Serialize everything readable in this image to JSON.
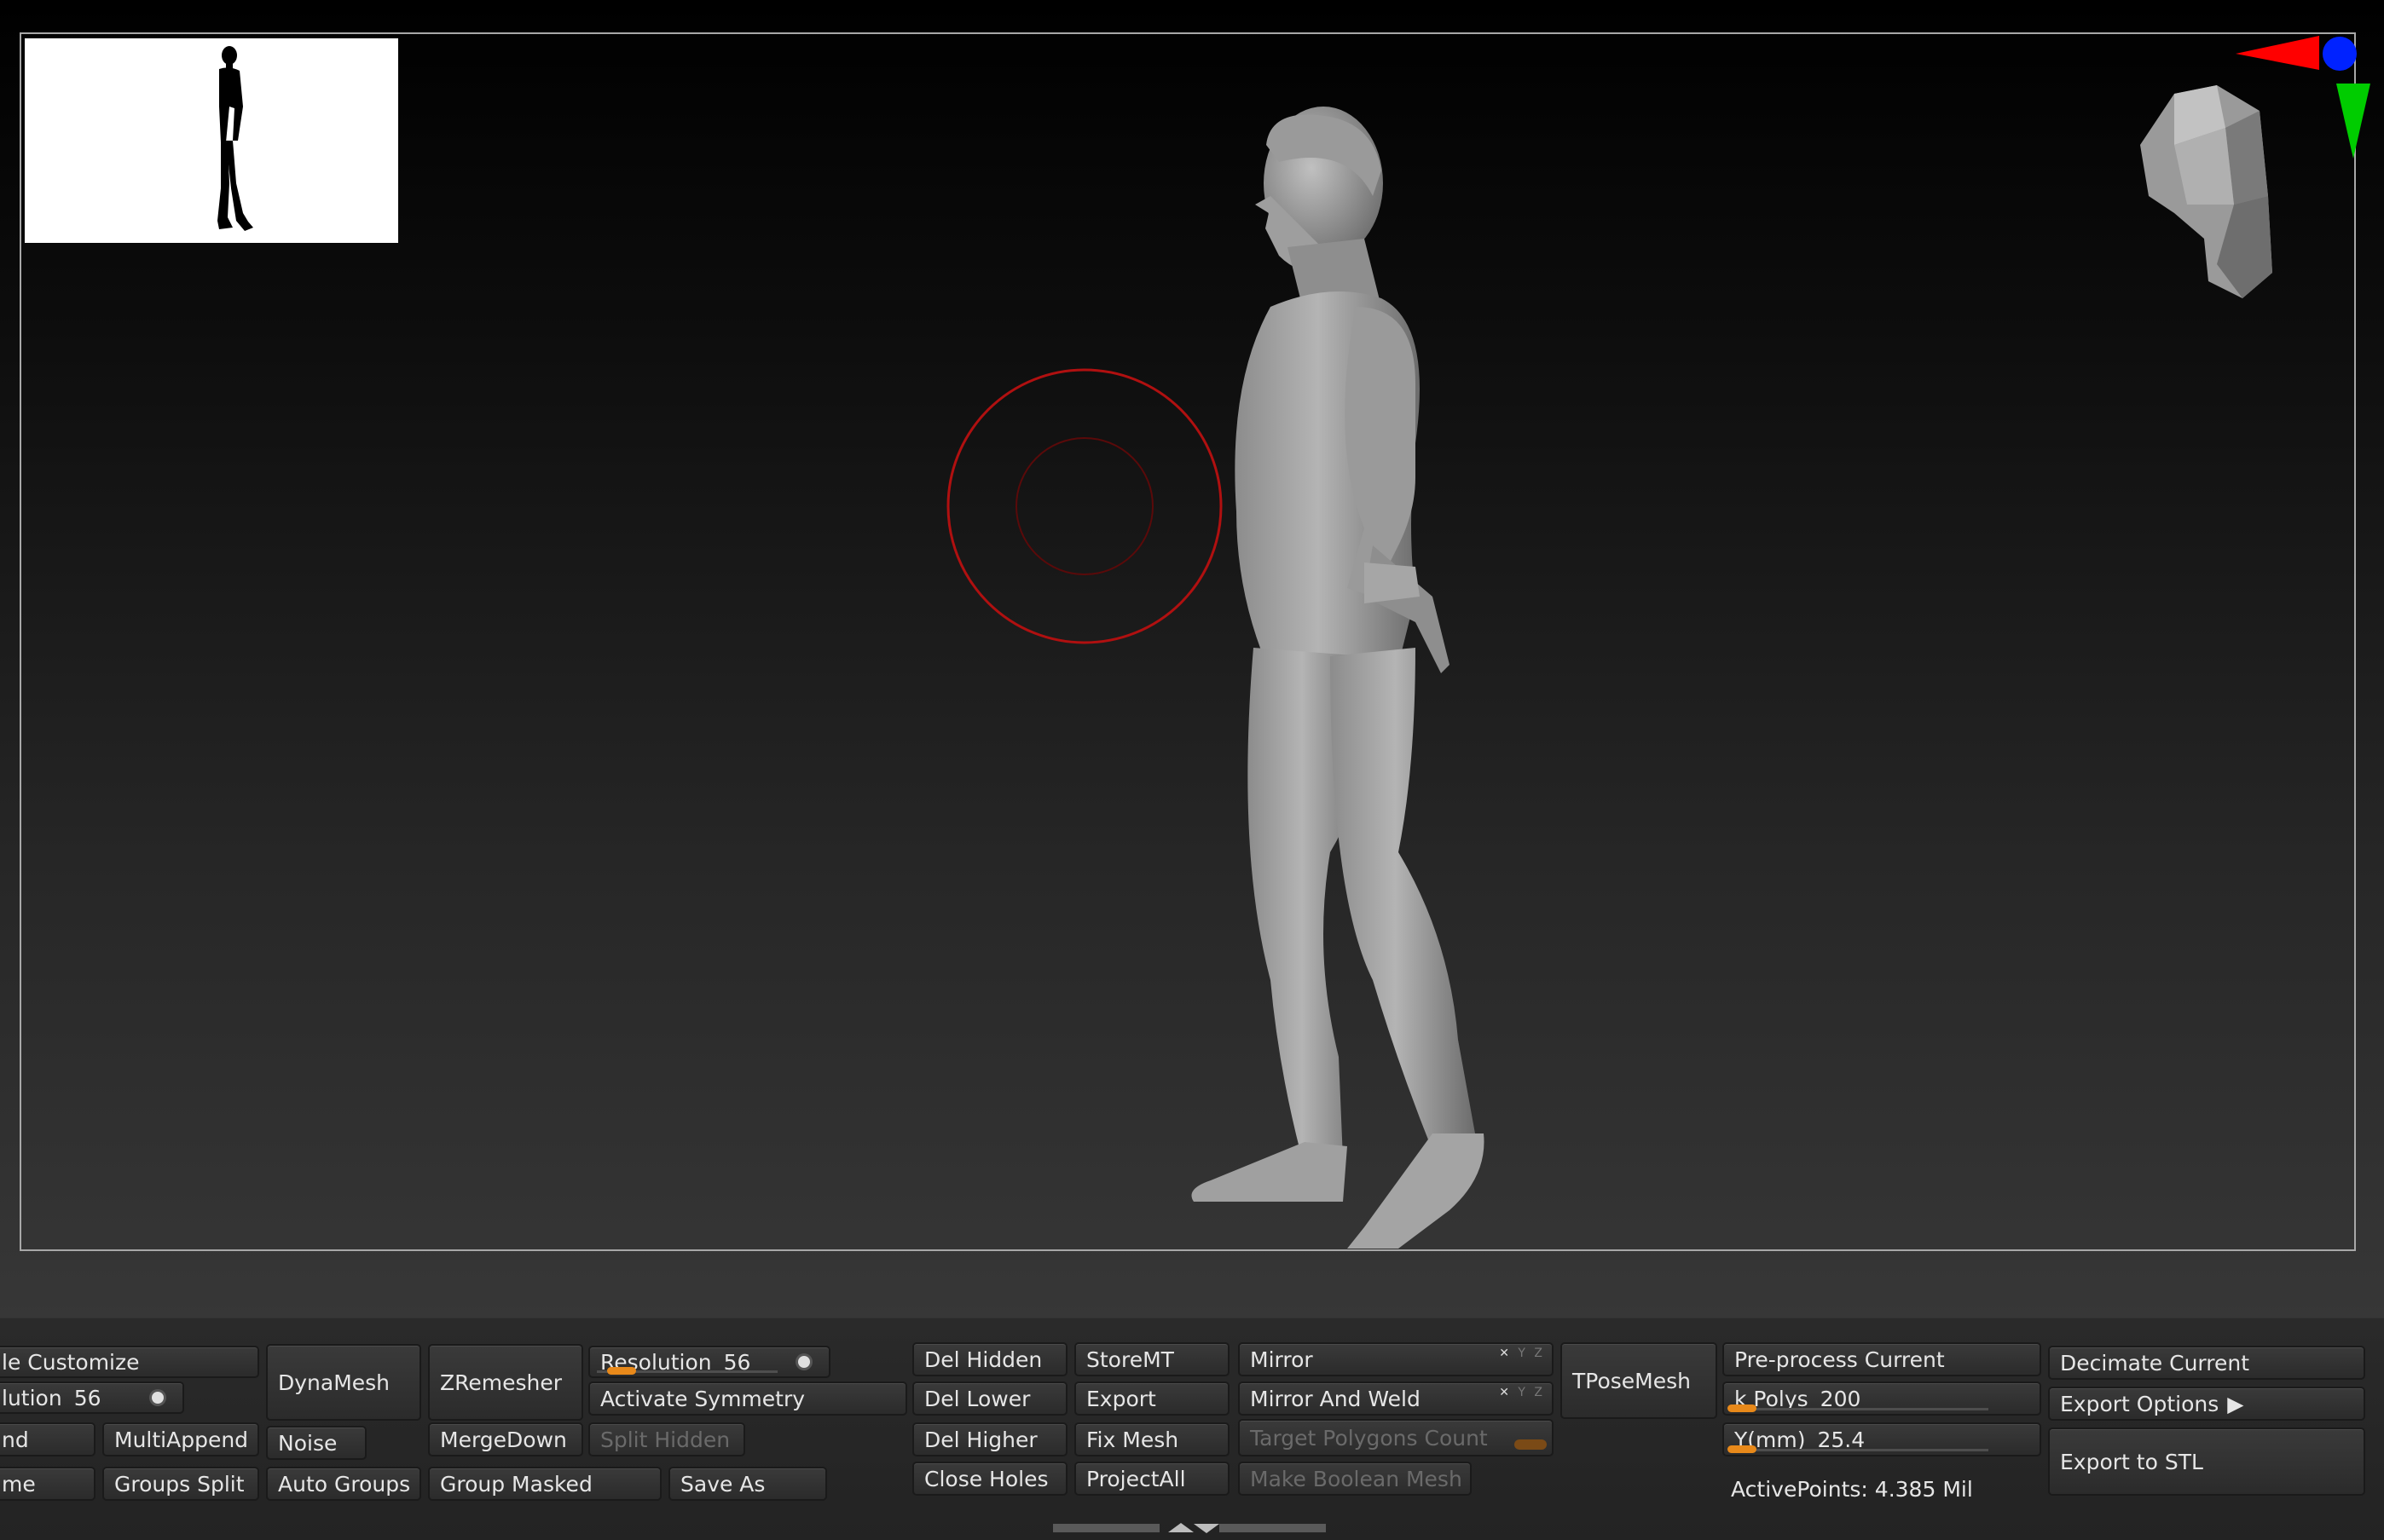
{
  "tray": {
    "col1": {
      "customize": "le Customize",
      "resolution_label": "lution",
      "resolution_value": "56",
      "append": "nd",
      "rename": "me"
    },
    "multiappend": "MultiAppend",
    "groups_split": "Groups Split",
    "dynamesh": "DynaMesh",
    "noise": "Noise",
    "auto_groups": "Auto Groups",
    "zremesher": "ZRemesher",
    "mergedown": "MergeDown",
    "group_masked": "Group Masked",
    "resolution": {
      "label": "Resolution",
      "value": "56",
      "level": 0.1
    },
    "activate_symmetry": "Activate Symmetry",
    "split_hidden": "Split Hidden",
    "save_as": "Save As",
    "del_hidden": "Del Hidden",
    "del_lower": "Del Lower",
    "del_higher": "Del Higher",
    "close_holes": "Close Holes",
    "storemt": "StoreMT",
    "export": "Export",
    "fix_mesh": "Fix Mesh",
    "projectall": "ProjectAll",
    "mirror": "Mirror",
    "mirror_and_weld": "Mirror And Weld",
    "target_polygons_count": "Target Polygons Count",
    "make_boolean_mesh": "Make Boolean Mesh",
    "tposemesh": "TPoseMesh",
    "preprocess_current": "Pre-process Current",
    "kpolys": {
      "label": "k Polys",
      "value": "200",
      "level": 0.05
    },
    "ymm": {
      "label": "Y(mm)",
      "value": "25.4",
      "level": 0.05
    },
    "active_points": "ActivePoints: 4.385 Mil",
    "decimate_current": "Decimate Current",
    "export_options": "Export Options",
    "export_to_stl": "Export to STL"
  },
  "colors": {
    "accent": "#e8891a",
    "brush_ring": "#b01010",
    "axis_x": "#ff0000",
    "axis_y": "#00cc00",
    "axis_z": "#0022ff"
  },
  "icons": [
    "silhouette-thumbnail",
    "head-gizmo-icon",
    "axis-arrows-icon",
    "brush-cursor-icon",
    "tray-handle-icon"
  ]
}
